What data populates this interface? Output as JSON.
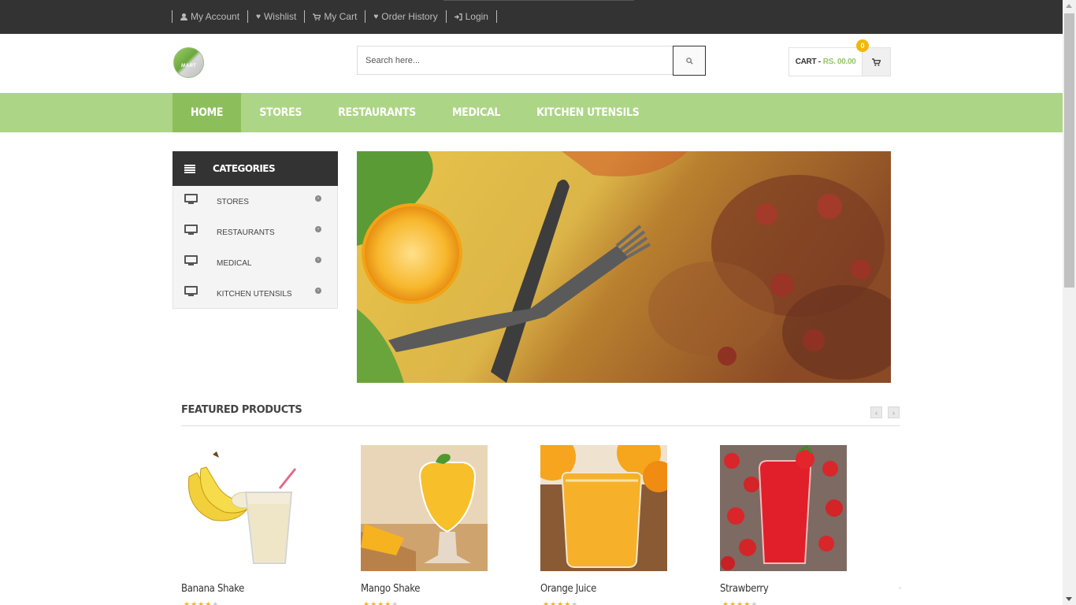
{
  "topbar": {
    "links": [
      {
        "label": "My Account",
        "icon": "user-icon"
      },
      {
        "label": "Wishlist",
        "icon": "heart-icon"
      },
      {
        "label": "My Cart",
        "icon": "cart-icon"
      },
      {
        "label": "Order History",
        "icon": "heart-icon"
      },
      {
        "label": "Login",
        "icon": "login-icon"
      }
    ]
  },
  "header": {
    "logo_text": "MART",
    "search_placeholder": "Search here...",
    "cart_label": "CART -",
    "cart_amount": "RS. 00.00",
    "cart_count": "0"
  },
  "nav": {
    "items": [
      "HOME",
      "STORES",
      "RESTAURANTS",
      "MEDICAL",
      "KITCHEN UTENSILS"
    ],
    "active": "HOME"
  },
  "categories": {
    "title": "CATEGORIES",
    "items": [
      "STORES",
      "RESTAURANTS",
      "MEDICAL",
      "KITCHEN UTENSILS"
    ]
  },
  "featured": {
    "title": "FEATURED PRODUCTS",
    "products": [
      {
        "name": "Banana Shake",
        "rating": 4
      },
      {
        "name": "Mango Shake",
        "rating": 4
      },
      {
        "name": "Orange Juice",
        "rating": 4
      },
      {
        "name": "Strawberry",
        "rating": 4
      }
    ]
  },
  "colors": {
    "nav_bg": "#acd585",
    "nav_active": "#8cbf5c",
    "topbar_bg": "#333333",
    "accent_price": "#94c666",
    "badge": "#f2b705"
  }
}
